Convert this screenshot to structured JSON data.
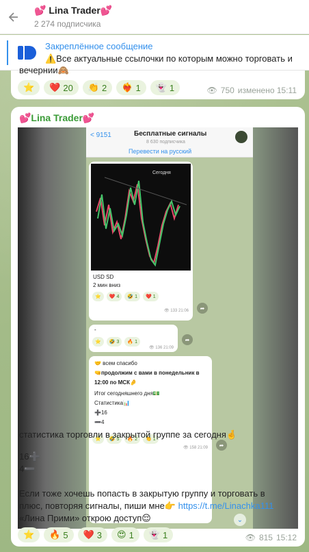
{
  "header": {
    "title": "💕 Lina Trader💕",
    "subtitle": "2 274 подписчика"
  },
  "pinned": {
    "title": "Закреплённое сообщение",
    "text": "⚠️Все актуальные ссылочки по которым можно торговать и"
  },
  "msg1": {
    "tail_text": "вечернии🙈",
    "reactions": [
      {
        "emoji": "⭐",
        "count": ""
      },
      {
        "emoji": "❤️",
        "count": "20"
      },
      {
        "emoji": "👏",
        "count": "2"
      },
      {
        "emoji": "❤️‍🔥",
        "count": "1"
      },
      {
        "emoji": "👻",
        "count": "1"
      }
    ],
    "views": "750",
    "edited": "изменено 15:11"
  },
  "post": {
    "author": "💕Lina Trader💕",
    "phone": {
      "back": "< 9151",
      "title": "Бесплатные сигналы",
      "subtitle": "8 630 подписчика",
      "translate": "Перевести на русский",
      "chart_label": "Сегодня",
      "card1_line1": "USD SD",
      "card1_line2": "2  мин вниз",
      "card1_reactions": [
        {
          "emoji": "⭐",
          "count": ""
        },
        {
          "emoji": "❤️",
          "count": "4"
        },
        {
          "emoji": "🤣",
          "count": "1"
        },
        {
          "emoji": "❤️",
          "count": "1"
        }
      ],
      "card1_meta": "👁 133 21:06",
      "card2_text": "-",
      "card2_reactions": [
        {
          "emoji": "⭐",
          "count": ""
        },
        {
          "emoji": "🤣",
          "count": "3"
        },
        {
          "emoji": "🔥",
          "count": "1"
        }
      ],
      "card2_meta": "👁 136 21:09",
      "card3_lines": [
        "🤝 всем спасибо",
        "🤜продолжим с вами в понедельник  в",
        "12:00 по МСК🤌",
        "Итог сегодняшнего дня💵",
        "Статистика📊",
        "➕16",
        "➖4"
      ],
      "card3_reactions": [
        {
          "emoji": "⭐",
          "count": ""
        },
        {
          "emoji": "🤣",
          "count": "5"
        },
        {
          "emoji": "🔥",
          "count": "2"
        },
        {
          "emoji": "👏",
          "count": "1"
        }
      ],
      "card3_meta": "👁 158 21:09"
    },
    "text_line1": "статистика торговли в закрытой группе за сегодня🤞",
    "plus_line": "16➕",
    "minus_line": "4➖",
    "cta_line1": "Если тоже хочешь попасть в закрытую группу и торговать в",
    "cta_line2_pre": "плюс,  повторяя сигналы, пиши мне👉 ",
    "cta_link": "https://t.me/Linachka111",
    "cta_line3": "«Лина Прими»  открою доступ😌",
    "reactions": [
      {
        "emoji": "⭐",
        "count": ""
      },
      {
        "emoji": "🔥",
        "count": "5"
      },
      {
        "emoji": "❤️",
        "count": "3"
      },
      {
        "emoji": "😍",
        "count": "1"
      },
      {
        "emoji": "👻",
        "count": "1"
      }
    ],
    "views": "815",
    "time": "15:12"
  },
  "colors": {
    "accent": "#3390ec",
    "author": "#3a9b37",
    "reaction_bg": "#eaf3df"
  }
}
